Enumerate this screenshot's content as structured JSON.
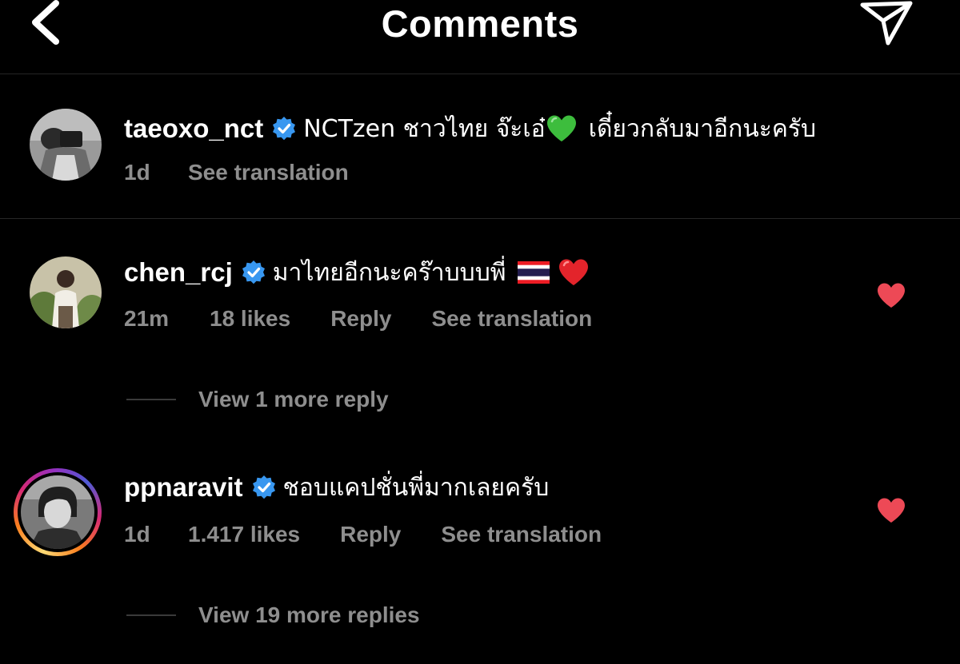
{
  "header": {
    "title": "Comments",
    "back_icon": "chevron-left-icon",
    "send_icon": "paper-plane-icon"
  },
  "colors": {
    "background": "#000000",
    "text_primary": "#ffffff",
    "text_secondary": "#8e8e8e",
    "verified": "#3897f0",
    "like_heart": "#ed4956",
    "divider": "#262626"
  },
  "caption": {
    "username": "taeoxo_nct",
    "verified": true,
    "text": "NCTzen ชาวไทย จ๊ะเอ๋",
    "emoji": "green-heart",
    "text_after": "เดี๋ยวกลับมาอีกนะครับ",
    "time": "1d",
    "see_translation": "See translation"
  },
  "comments": [
    {
      "username": "chen_rcj",
      "verified": true,
      "text": "มาไทยอีกนะคร๊าบบบพี่",
      "emojis": [
        "thailand-flag",
        "red-heart"
      ],
      "time": "21m",
      "likes": "18 likes",
      "reply": "Reply",
      "see_translation": "See translation",
      "liked": true,
      "view_replies": "View 1 more reply"
    },
    {
      "username": "ppnaravit",
      "verified": true,
      "has_story_ring": true,
      "text": "ชอบแคปชั่นพี่มากเลยครับ",
      "time": "1d",
      "likes": "1.417 likes",
      "reply": "Reply",
      "see_translation": "See translation",
      "liked": true,
      "view_replies": "View 19 more replies"
    }
  ]
}
